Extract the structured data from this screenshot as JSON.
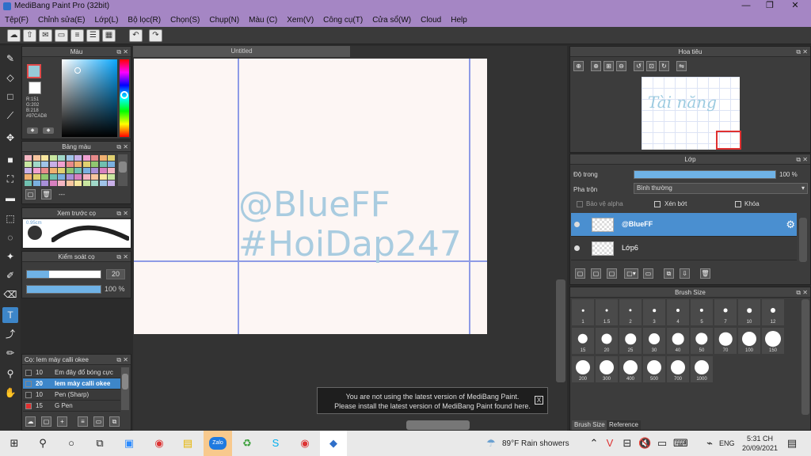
{
  "window": {
    "title": "MediBang Paint Pro (32bit)",
    "min": "—",
    "max": "❐",
    "close": "✕"
  },
  "menu": [
    "Tệp(F)",
    "Chỉnh sửa(E)",
    "Lớp(L)",
    "Bộ lọc(R)",
    "Chọn(S)",
    "Chụp(N)",
    "Màu (C)",
    "Xem(V)",
    "Công cụ(T)",
    "Cửa sổ(W)",
    "Cloud",
    "Help"
  ],
  "color_panel": {
    "title": "Màu",
    "r": "R:151",
    "g": "G:202",
    "b": "B:218",
    "hex": "#97CAD8",
    "fg": "#97CAD8"
  },
  "palette_panel": {
    "title": "Bảng màu",
    "name": "---"
  },
  "brush_preview": {
    "title": "Xem trước cọ",
    "value": "0.95cm"
  },
  "brush_control": {
    "title": "Kiểm soát cọ",
    "size": "20",
    "opacity": "100 %",
    "size_frac": 0.3,
    "opacity_frac": 1
  },
  "brush_list": {
    "title": "Cọ: Iem mày calli okee",
    "items": [
      {
        "size": "10",
        "name": "Em đây đổ bóng cực",
        "selected": false,
        "color": "#333"
      },
      {
        "size": "20",
        "name": "Iem mày calli okee",
        "selected": true,
        "color": "#3d86c9"
      },
      {
        "size": "10",
        "name": "Pen (Sharp)",
        "selected": false,
        "color": "#333"
      },
      {
        "size": "15",
        "name": "G Pen",
        "selected": false,
        "color": "#e03030"
      }
    ]
  },
  "canvas": {
    "tab": "Untitled",
    "line1": "@BlueFF",
    "line2": "#HoiDap247"
  },
  "navigator": {
    "title": "Hoa tiêu",
    "preview_text": "Tài năng"
  },
  "layer_panel": {
    "title": "Lớp",
    "opacity_label": "Độ trong",
    "opacity_value": "100 %",
    "opacity_frac": 1,
    "blend_label": "Pha trộn",
    "blend_value": "Bình thường",
    "protect_alpha": "Bảo vệ alpha",
    "clip": "Xén bớt",
    "lock": "Khóa",
    "layers": [
      {
        "name": "@BlueFF",
        "selected": true
      },
      {
        "name": "Lớp6",
        "selected": false
      }
    ]
  },
  "brush_size_panel": {
    "title": "Brush Size",
    "sizes": [
      "1",
      "1.5",
      "2",
      "3",
      "4",
      "5",
      "7",
      "10",
      "12",
      "15",
      "20",
      "25",
      "30",
      "40",
      "50",
      "70",
      "100",
      "150",
      "200",
      "300",
      "400",
      "500",
      "700",
      "1000"
    ],
    "tab1": "Brush Size",
    "tab2": "Reference"
  },
  "notification": {
    "line1": "You are not using the latest version of MediBang Paint.",
    "line2": "Please install the latest version of MediBang Paint found here.",
    "close": "X"
  },
  "taskbar": {
    "weather": "89°F  Rain showers",
    "lang": "ENG",
    "time": "5:31 CH",
    "date": "20/09/2021",
    "zalo": "Zalo"
  }
}
